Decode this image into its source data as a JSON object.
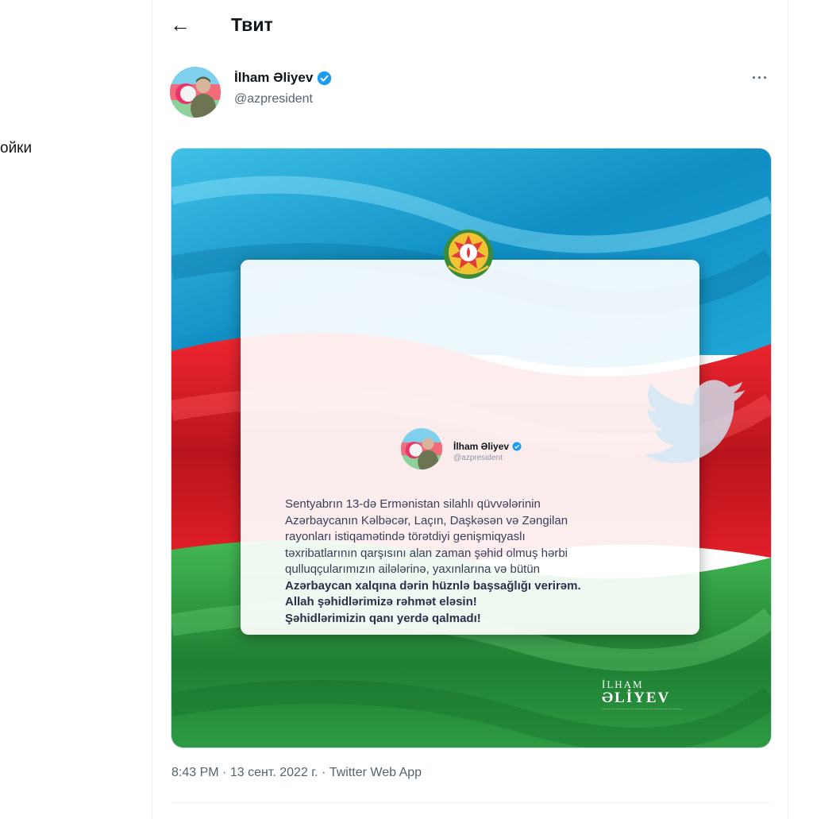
{
  "sidebar": {
    "settings_fragment": "ойки"
  },
  "header": {
    "back_icon": "arrow-left-icon",
    "title": "Твит"
  },
  "tweet": {
    "author": {
      "name": "İlham Əliyev",
      "handle": "@azpresident",
      "verified_icon": "verified-badge-icon"
    },
    "more_icon": "more-horizontal-icon",
    "media": {
      "card_author": {
        "name": "İlham Əliyev",
        "handle": "@azpresident"
      },
      "text_regular": [
        "Sentyabrın 13-də Ermənistan silahlı qüvvələrinin",
        "Azərbaycanın Kəlbəcər, Laçın, Daşkəsən və Zəngilan",
        "rayonları istiqamətində törətdiyi genişmiqyaslı",
        "təxribatlarının qarşısını alan zaman şəhid olmuş hərbi",
        "qulluqçularımızın ailələrinə, yaxınlarına və bütün"
      ],
      "text_bold": [
        "Azərbaycan xalqına dərin hüznlə başsağlığı verirəm.",
        "Allah şəhidlərimizə rəhmət eləsin!",
        "Şəhidlərimizin qanı yerdə qalmadı!"
      ],
      "signature": {
        "top": "İLHAM",
        "main": "ƏLİYEV"
      }
    },
    "time": "8:43 PM",
    "separator": "·",
    "date": "13 сент. 2022 г.",
    "source": "Twitter Web App"
  },
  "colors": {
    "flag_blue": "#19a5d6",
    "flag_red": "#e3202b",
    "flag_green": "#2fa043",
    "verified": "#1d9bf0",
    "secondary_text": "#536471"
  }
}
